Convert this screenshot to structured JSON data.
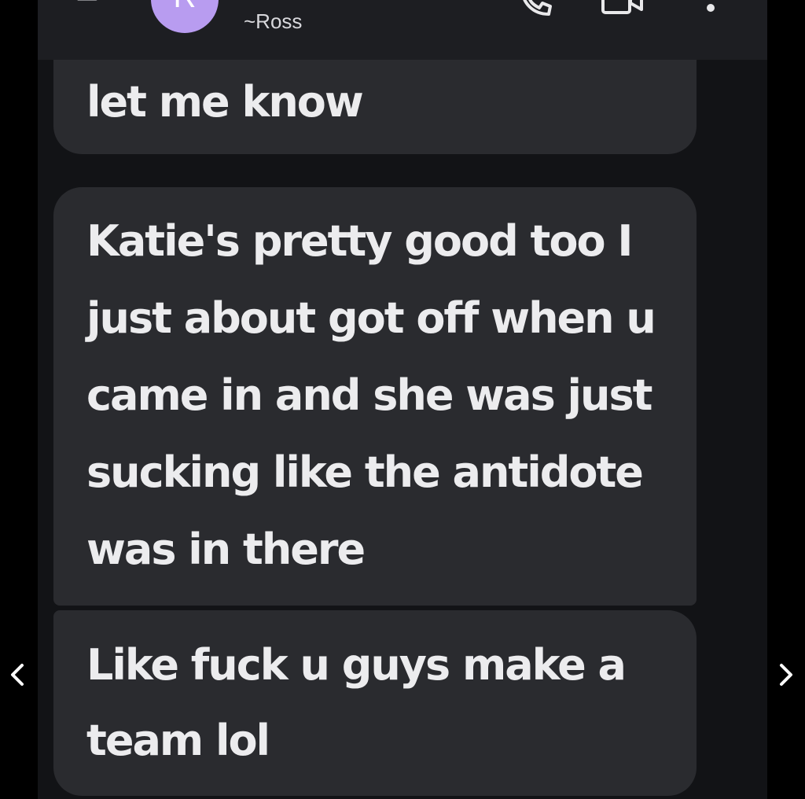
{
  "header": {
    "avatar_initial": "R",
    "contact_name": "~Ross",
    "back_icon": "back-arrow-icon",
    "call_icon": "phone-icon",
    "video_icon": "video-camera-icon",
    "more_icon": "more-vertical-icon"
  },
  "messages": [
    {
      "text": "let me know"
    },
    {
      "text": "Katie's pretty good too I just about got off when u came in and she was just sucking like the antidote was in there"
    },
    {
      "text": "Like fuck u guys make a team lol"
    }
  ],
  "navigation": {
    "prev_icon": "chevron-left-icon",
    "next_icon": "chevron-right-icon"
  },
  "colors": {
    "background": "#000000",
    "chat_background": "#121316",
    "header_background": "#1d1e22",
    "bubble": "#2a2b2f",
    "bubble_text": "#ececee",
    "avatar": "#b89cf0"
  }
}
